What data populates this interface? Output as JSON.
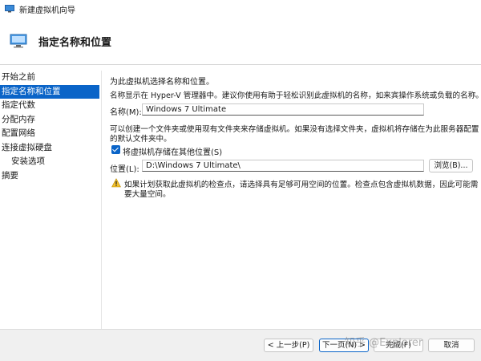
{
  "window": {
    "title": "新建虚拟机向导"
  },
  "header": {
    "title": "指定名称和位置"
  },
  "nav": {
    "items": [
      {
        "label": "开始之前",
        "selected": false,
        "sub": false
      },
      {
        "label": "指定名称和位置",
        "selected": true,
        "sub": false
      },
      {
        "label": "指定代数",
        "selected": false,
        "sub": false
      },
      {
        "label": "分配内存",
        "selected": false,
        "sub": false
      },
      {
        "label": "配置网络",
        "selected": false,
        "sub": false
      },
      {
        "label": "连接虚拟硬盘",
        "selected": false,
        "sub": false
      },
      {
        "label": "安装选项",
        "selected": false,
        "sub": true
      },
      {
        "label": "摘要",
        "selected": false,
        "sub": false
      }
    ]
  },
  "content": {
    "intro": "为此虚拟机选择名称和位置。",
    "name_hint": "名称显示在 Hyper-V 管理器中。建议你使用有助于轻松识别此虚拟机的名称，如来宾操作系统或负载的名称。",
    "name_label": "名称(M):",
    "name_value": "Windows 7 Ultimate",
    "folder_hint_1": "可以创建一个文件夹或使用现有文件夹来存储虚拟机。如果没有选择文件夹，虚拟机将存储在为此服务器配置",
    "folder_hint_2": "的默认文件夹中。",
    "checkbox_label": "将虚拟机存储在其他位置(S)",
    "checkbox_checked": true,
    "location_label": "位置(L):",
    "location_value": "D:\\Windows 7 Ultimate\\",
    "browse_label": "浏览(B)...",
    "warning_1": "如果计划获取此虚拟机的检查点，请选择具有足够可用空间的位置。检查点包含虚拟机数据，因此可能需",
    "warning_2": "要大量空间。"
  },
  "footer": {
    "prev_label": "< 上一步(P)",
    "next_label": "下一页(N) >",
    "finish_label": "完成(F)",
    "cancel_label": "取消"
  },
  "watermark": "知乎 @Explorer",
  "colors": {
    "accent": "#0a64c8",
    "warning": "#f2c12e"
  }
}
